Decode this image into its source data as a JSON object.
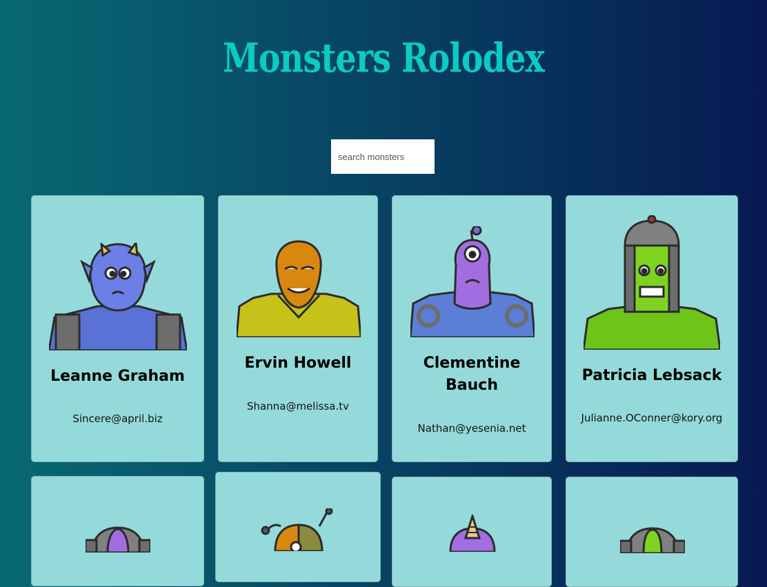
{
  "app": {
    "title": "Monsters Rolodex"
  },
  "search": {
    "placeholder": "search monsters",
    "value": ""
  },
  "monsters": [
    {
      "name": "Leanne Graham",
      "email": "Sincere@april.biz",
      "skin": "#6b7fe6",
      "suit": "#5a72d6",
      "accent": "#e7c44a"
    },
    {
      "name": "Ervin Howell",
      "email": "Shanna@melissa.tv",
      "skin": "#d9880f",
      "suit": "#c6c219",
      "accent": "#d9880f"
    },
    {
      "name": "Clementine Bauch",
      "email": "Nathan@yesenia.net",
      "skin": "#a26de0",
      "suit": "#5b7fd6",
      "accent": "#7e66d6"
    },
    {
      "name": "Patricia Lebsack",
      "email": "Julianne.OConner@kory.org",
      "skin": "#7ed321",
      "suit": "#6fc41a",
      "accent": "#808080"
    },
    {
      "name": "",
      "email": "",
      "skin": "#a26de0",
      "suit": "#808080",
      "accent": "#808080"
    },
    {
      "name": "",
      "email": "",
      "skin": "#d9880f",
      "suit": "#808080",
      "accent": "#808080"
    },
    {
      "name": "",
      "email": "",
      "skin": "#a26de0",
      "suit": "#808080",
      "accent": "#e9c98c"
    },
    {
      "name": "",
      "email": "",
      "skin": "#7ed321",
      "suit": "#808080",
      "accent": "#808080"
    }
  ]
}
